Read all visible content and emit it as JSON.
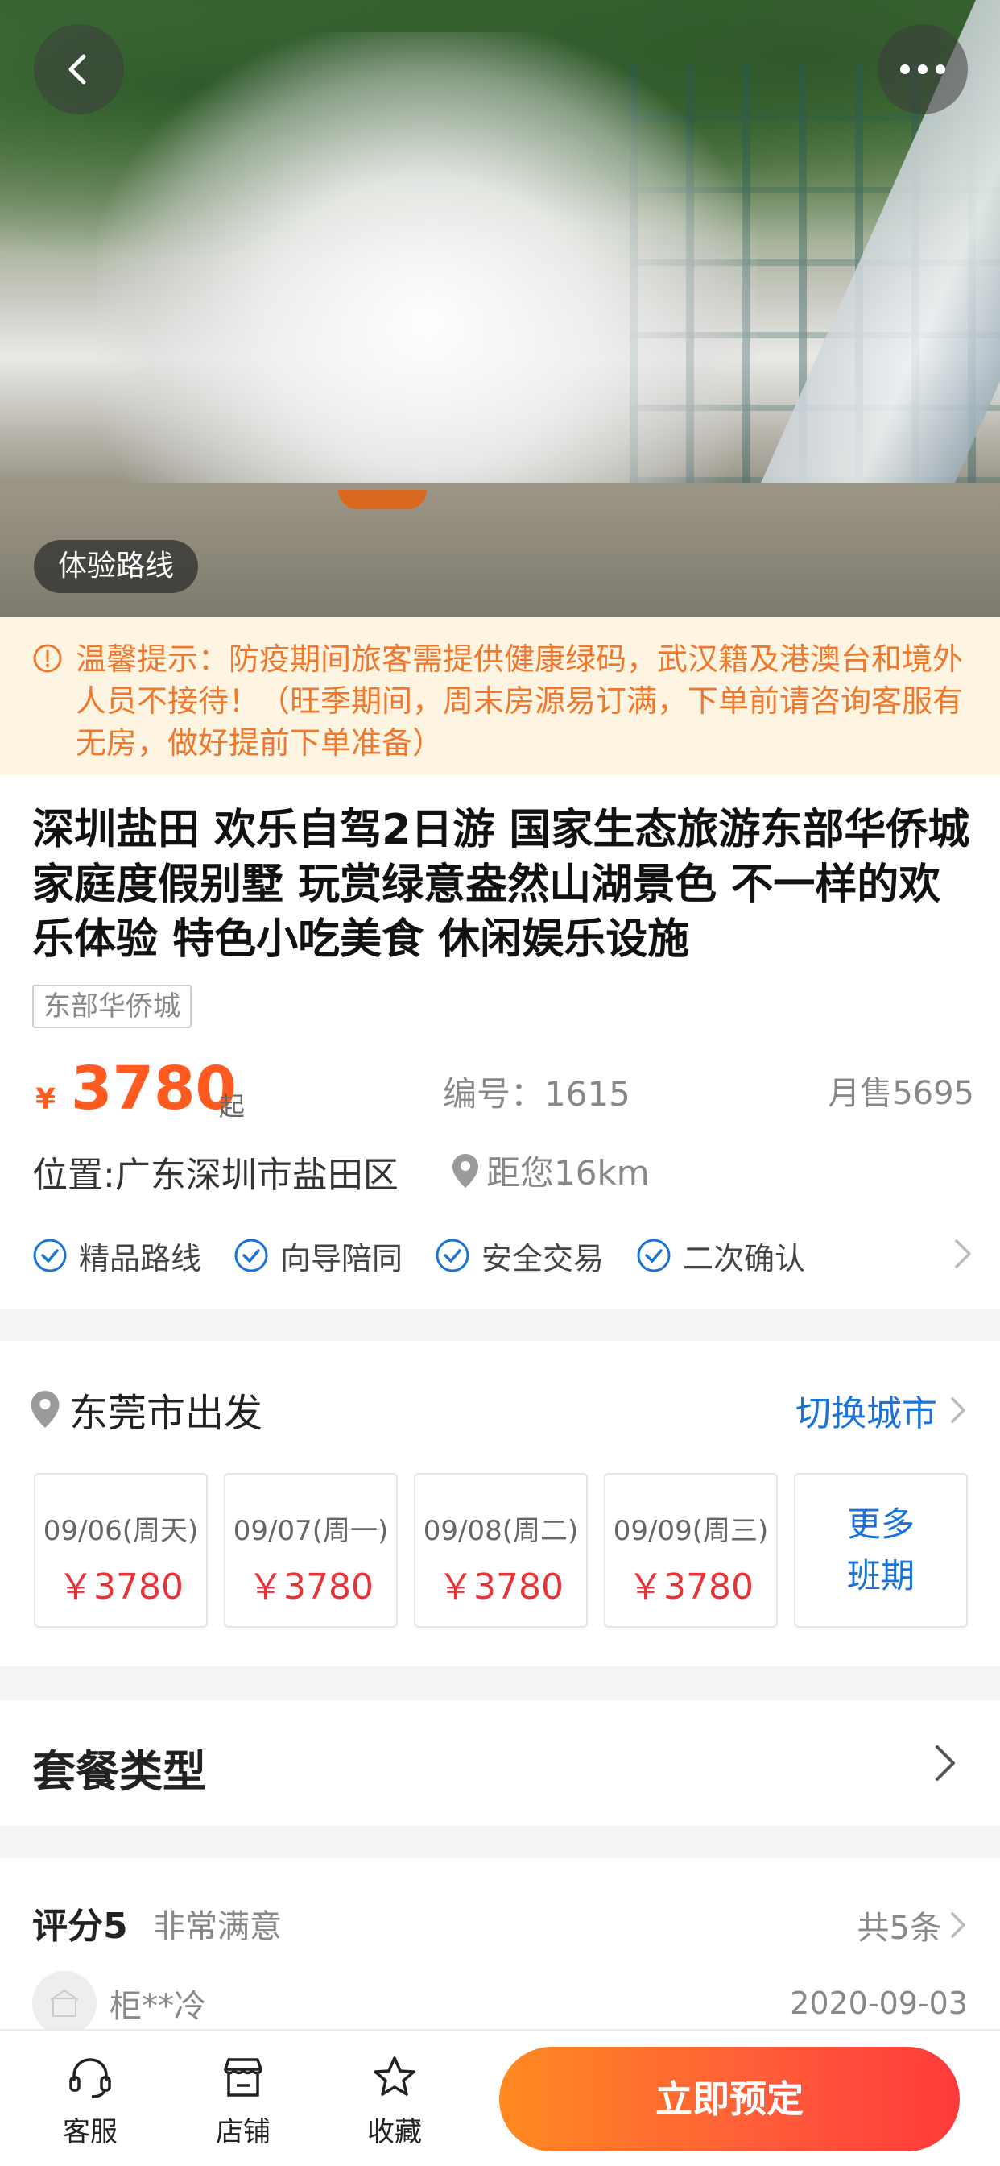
{
  "hero": {
    "route_tag": "体验路线",
    "icons": {
      "back": "chevron-left-icon",
      "more": "more-dots-icon"
    }
  },
  "notice": {
    "text": "温馨提示：防疫期间旅客需提供健康绿码，武汉籍及港澳台和境外人员不接待！（旺季期间，周末房源易订满，下单前请咨询客服有无房，做好提前下单准备）",
    "icon": "alert-circle-icon",
    "color": "#f0782c"
  },
  "product": {
    "title": "深圳盐田 欢乐自驾2日游 国家生态旅游东部华侨城 家庭度假别墅 玩赏绿意盎然山湖景色 不一样的欢乐体验 特色小吃美食 休闲娱乐设施",
    "chip": "东部华侨城",
    "price_symbol": "¥",
    "price": "3780",
    "price_suffix": "起",
    "code": "编号：1615",
    "sales": "月售5695",
    "location": "位置:广东深圳市盐田区",
    "distance": "距您16km",
    "features": [
      "精品路线",
      "向导陪同",
      "安全交易",
      "二次确认"
    ]
  },
  "departure": {
    "city": "东莞市出发",
    "switch_label": "切换城市",
    "dates": [
      {
        "date": "09/06(周天)",
        "price": "￥3780"
      },
      {
        "date": "09/07(周一)",
        "price": "￥3780"
      },
      {
        "date": "09/08(周二)",
        "price": "￥3780"
      },
      {
        "date": "09/09(周三)",
        "price": "￥3780"
      }
    ],
    "more_line1": "更多",
    "more_line2": "班期"
  },
  "package": {
    "label": "套餐类型"
  },
  "reviews": {
    "score": "评分5",
    "sub": "非常满意",
    "total": "共5条",
    "user": "柜**冷",
    "date": "2020-09-03"
  },
  "bottom_bar": {
    "tabs": [
      {
        "label": "客服",
        "icon": "headset-icon"
      },
      {
        "label": "店铺",
        "icon": "store-icon"
      },
      {
        "label": "收藏",
        "icon": "star-icon"
      }
    ],
    "book_label": "立即预定"
  },
  "colors": {
    "accent_orange": "#ff5a1f",
    "price_red": "#e6333a",
    "link_blue": "#1a73d9",
    "notice_bg": "#fdf5e2"
  }
}
